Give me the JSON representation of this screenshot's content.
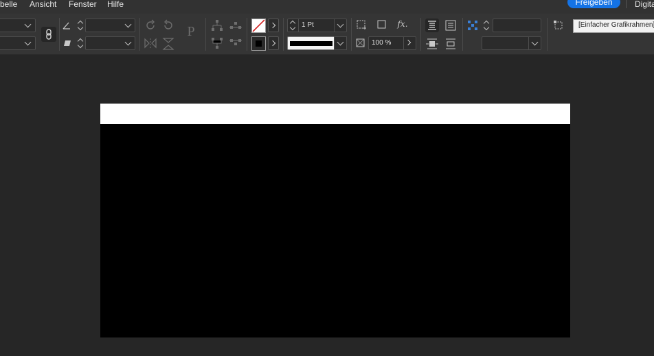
{
  "menubar": {
    "items": [
      "belle",
      "Ansicht",
      "Fenster",
      "Hilfe"
    ],
    "share_label": "Freigeben",
    "right_label": "Digita"
  },
  "controlbar": {
    "stroke_weight": "1 Pt",
    "opacity": "100 %",
    "object_style": "[Einfacher Grafikrahmen]",
    "p_label": "P",
    "fx_label": "fx."
  },
  "colors": {
    "accent": "#1473e6",
    "stroke_none_slash": "#d31f1f",
    "canvas": "#262626",
    "fill_swatch": "#000000",
    "page_top": "#ffffff",
    "page_image": "#000000"
  },
  "icons": [
    "chain-link-icon",
    "rotate-angle-icon",
    "shear-icon",
    "rotate-cw-icon",
    "rotate-ccw-icon",
    "flip-horizontal-icon",
    "flip-vertical-icon",
    "align-icons",
    "fx-icon",
    "frame-fit-icons",
    "object-style-icon"
  ]
}
